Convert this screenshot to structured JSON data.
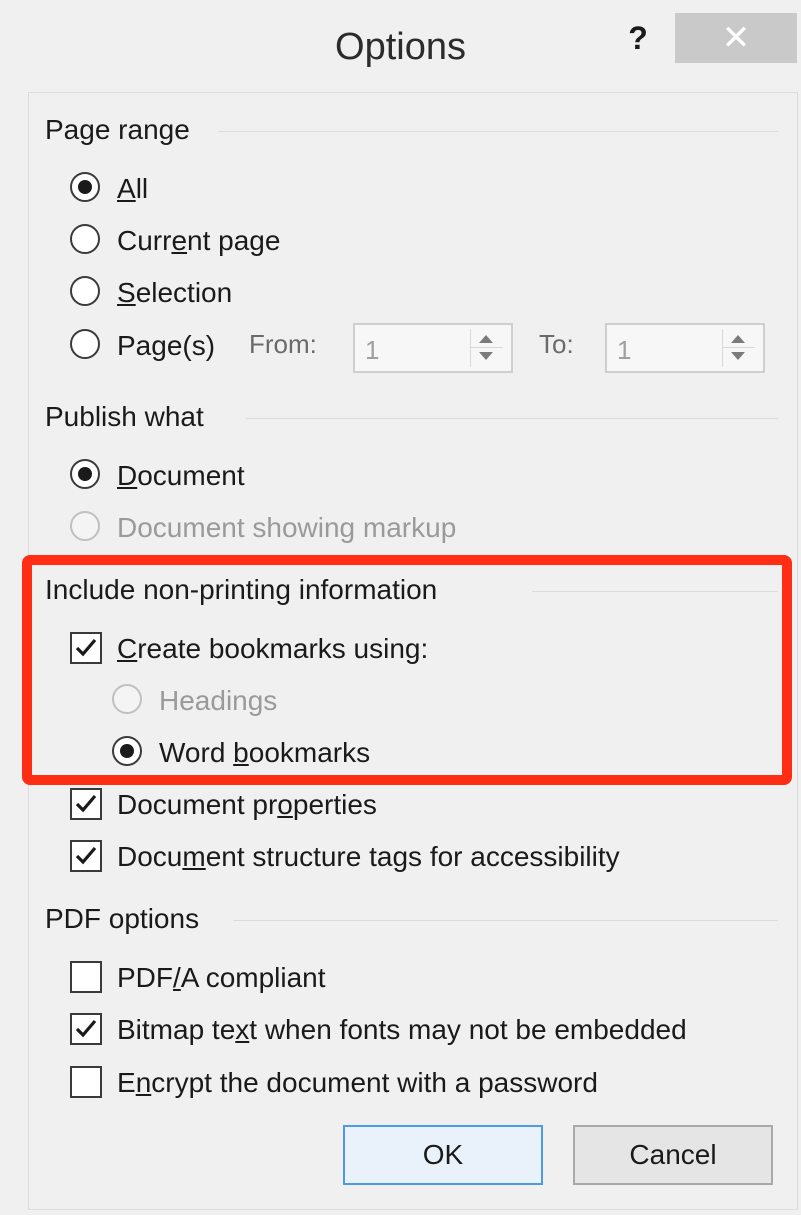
{
  "window": {
    "title": "Options",
    "help_label": "?",
    "close_label": "✕"
  },
  "page_range": {
    "label": "Page range",
    "all": {
      "pre": "",
      "u": "A",
      "post": "ll"
    },
    "current_page": {
      "pre": "Curr",
      "u": "e",
      "post": "nt page"
    },
    "selection": {
      "pre": "",
      "u": "S",
      "post": "election"
    },
    "pages": {
      "pre": "Pa",
      "u": "g",
      "post": "e(s)"
    },
    "from_label": "From:",
    "from_value": "1",
    "to_label": "To:",
    "to_value": "1",
    "selected": "All"
  },
  "publish_what": {
    "label": "Publish what",
    "document": {
      "pre": "",
      "u": "D",
      "post": "ocument"
    },
    "document_markup": "Document showing markup",
    "selected": "Document"
  },
  "non_printing": {
    "label": "Include non-printing information",
    "create_bookmarks": {
      "pre": "",
      "u": "C",
      "post": "reate bookmarks using:",
      "checked": true
    },
    "headings": "Headings",
    "word_bookmarks": {
      "pre": "Word ",
      "u": "b",
      "post": "ookmarks"
    },
    "document_properties": {
      "pre": "Document pr",
      "u": "o",
      "post": "perties",
      "checked": true
    },
    "structure_tags": {
      "pre": "Docu",
      "u": "m",
      "post": "ent structure tags for accessibility",
      "checked": true
    }
  },
  "pdf_options": {
    "label": "PDF options",
    "pdfa": {
      "pre": "PDF",
      "u": "/",
      "post": "A compliant",
      "checked": false
    },
    "bitmap": {
      "pre": "Bitmap te",
      "u": "x",
      "post": "t when fonts may not be embedded",
      "checked": true
    },
    "encrypt": {
      "pre": "E",
      "u": "n",
      "post": "crypt the document with a password",
      "checked": false
    }
  },
  "buttons": {
    "ok": "OK",
    "cancel": "Cancel"
  },
  "colors": {
    "highlight": "#ff2d14",
    "ok_border": "#4d9be6",
    "dialog_bg": "#f0f0f0"
  }
}
